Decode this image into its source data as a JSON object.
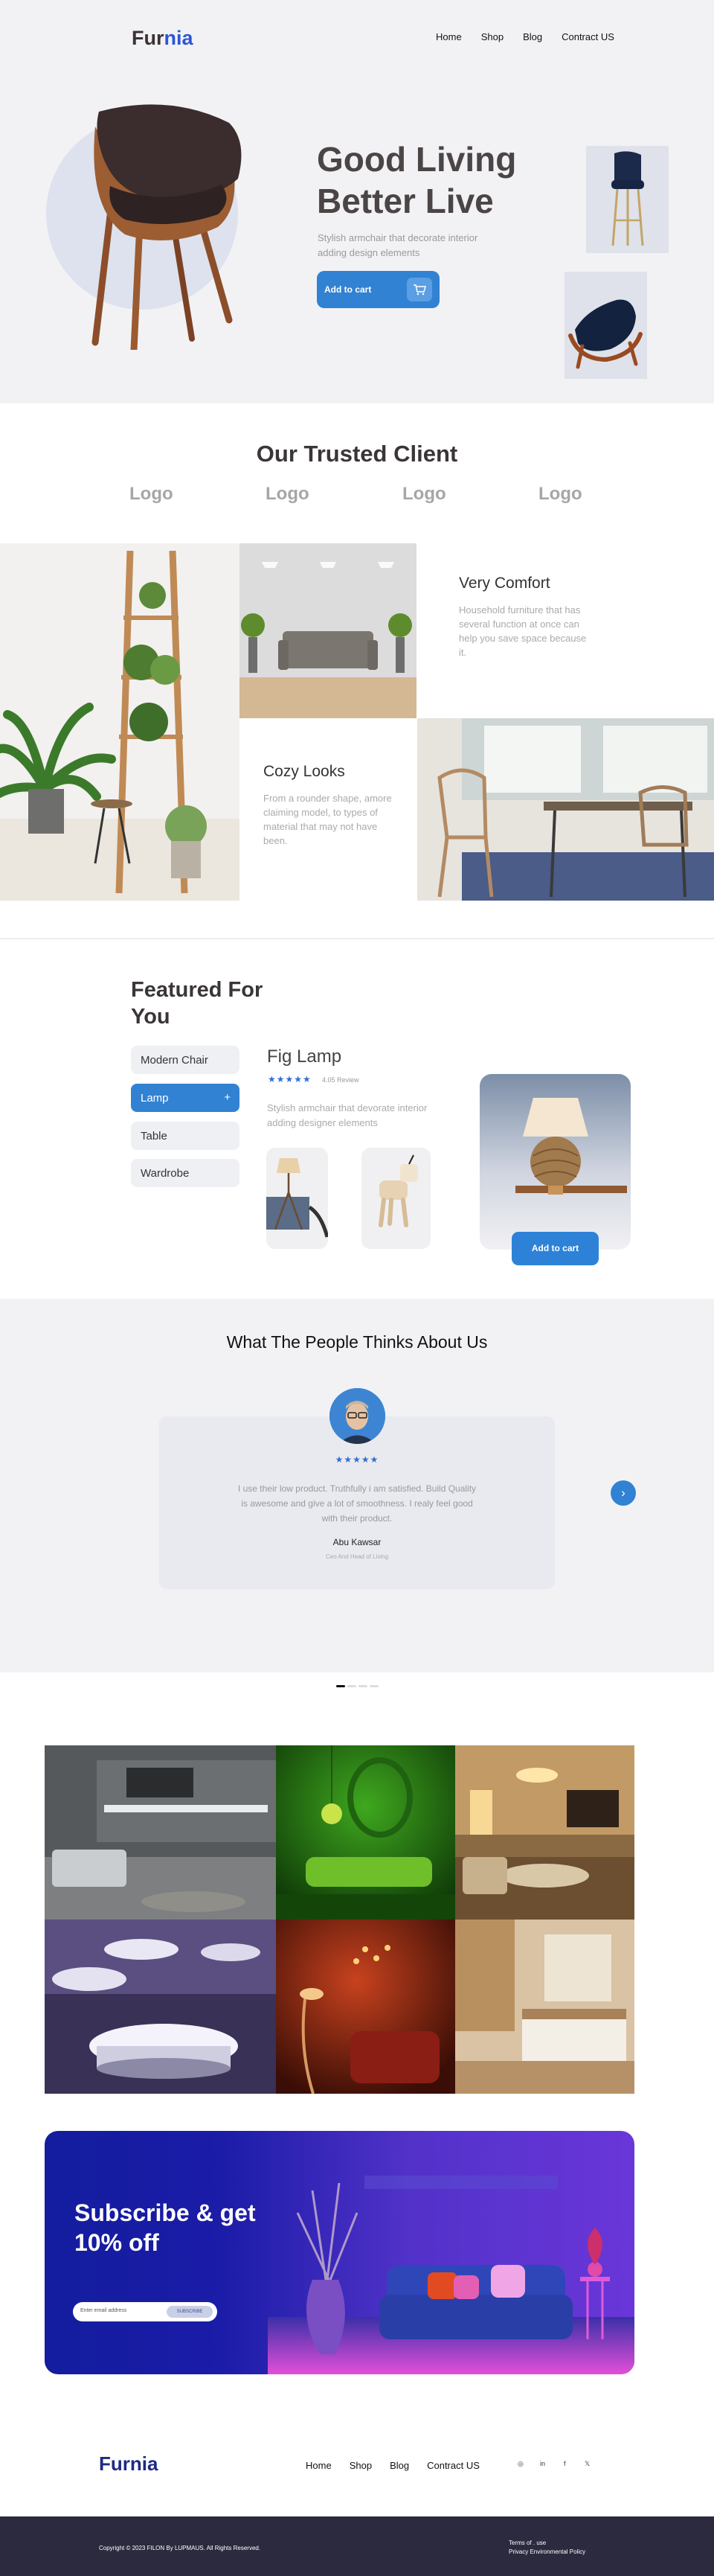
{
  "brand": {
    "name_part1": "Fur",
    "name_part2": "nia",
    "accent": "#2b57d6",
    "primary": "#3182d2"
  },
  "nav": {
    "items": [
      "Home",
      "Shop",
      "Blog",
      "Contract US"
    ]
  },
  "hero": {
    "headline_line1": "Good Living",
    "headline_line2": "Better Live",
    "subtitle": "Stylish armchair that decorate interior adding design elements",
    "cta_label": "Add to cart",
    "cta_icon": "cart-icon"
  },
  "trusted": {
    "title": "Our Trusted Client",
    "logos": [
      "Logo",
      "Logo",
      "Logo",
      "Logo"
    ]
  },
  "features": [
    {
      "title": "Very Comfort",
      "text": "Household furniture that has several function at once can help you save space because it."
    },
    {
      "title": "Cozy Looks",
      "text": "From a rounder shape, amore claiming model, to types of material that may not have been."
    }
  ],
  "featured": {
    "title_line1": "Featured For",
    "title_line2": "You",
    "categories": [
      "Modern Chair",
      "Lamp",
      "Table",
      "Wardrobe"
    ],
    "active_category": "Lamp",
    "active_icon": "+",
    "product_title": "Fig Lamp",
    "stars": "★★★★★",
    "rating": 5,
    "review_text": "4.05 Review",
    "description": "Stylish armchair that devorate interior adding designer elements",
    "add_label": "Add to cart"
  },
  "testimonial": {
    "title": "What The People Thinks About Us",
    "stars": "★★★★★",
    "rating": 5,
    "quote": "I use their low product. Truthfully i am satisfied. Build Quality is awesome and give a lot of smoothness. I realy feel good with their product.",
    "name": "Abu Kawsar",
    "role": "Ceo And Head of Living",
    "next_icon": "›",
    "dots_total": 4,
    "dot_active": 1
  },
  "subscribe": {
    "title_line1": "Subscribe & get",
    "title_line2": "10% off",
    "placeholder": "Enter email address",
    "button": "SUBSCRIBE"
  },
  "footer": {
    "logo": "Furnia",
    "nav": [
      "Home",
      "Shop",
      "Blog",
      "Contract US"
    ],
    "social": [
      "instagram-icon",
      "linkedin-icon",
      "facebook-icon",
      "twitter-icon"
    ],
    "social_glyphs": [
      "◎",
      "in",
      "f",
      "𝕏"
    ],
    "copyright": "Copyright © 2023 FILON By LUPMAUS. All Rights Reserved.",
    "terms": "Terms of . use",
    "privacy": "Privacy Environmental Policy"
  }
}
